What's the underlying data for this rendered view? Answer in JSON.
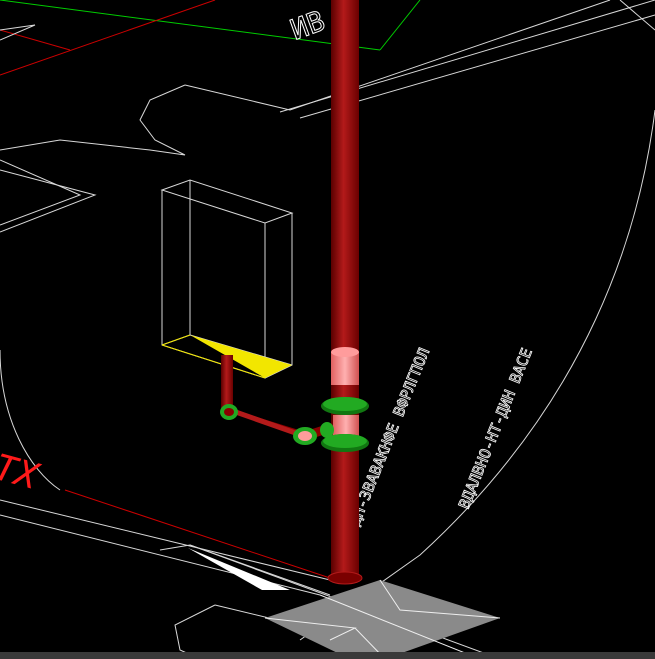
{
  "viewport": {
    "label": "",
    "background_color": "#000000"
  },
  "colors": {
    "pipe_dark": "#8b0000",
    "pipe_highlight": "#b31a1a",
    "pipe_light": "#ff8c8c",
    "fitting_green": "#22aa22",
    "fitting_green_dark": "#117711",
    "wireframe": "#d8d8d8",
    "grid_green": "#00cc00",
    "grid_red": "#cc0000",
    "highlight_yellow": "#f2e600",
    "slab_gray": "#8a8a8a",
    "statusbar": "#3a3a3a"
  },
  "annotations": {
    "red_label": "TX",
    "vertical_text_left": "ПМ-1ДН-3ВАВАКНФЕ ВФРЛГПОЛ",
    "vertical_text_right": "ВДАЛВНО-НТ-ДИН ВАСЕ",
    "top_text": "ИВ"
  },
  "icons": {
    "riser_pipe": "vertical-pipe-icon",
    "branch_pipe": "branch-pipe-icon",
    "fitting": "pipe-fitting-icon"
  }
}
